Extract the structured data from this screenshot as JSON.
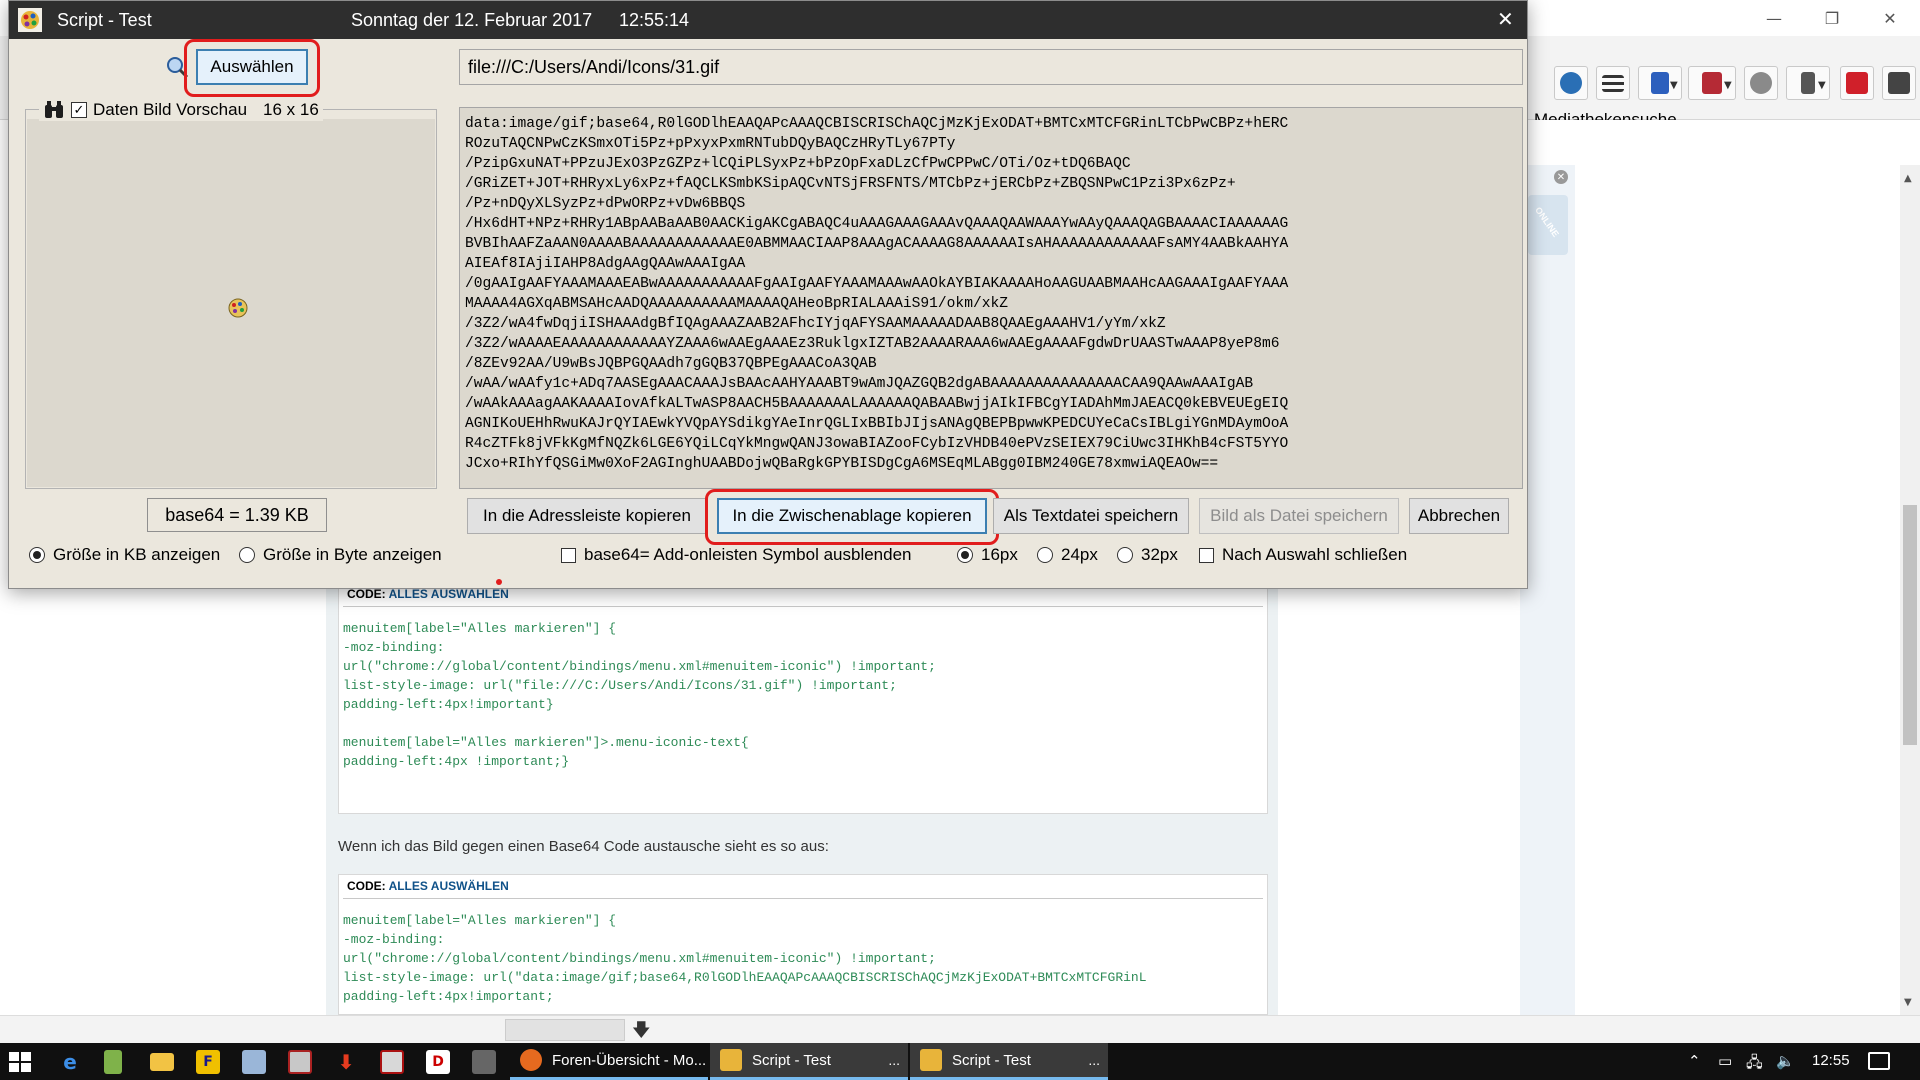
{
  "browser": {
    "bookmark": "Mediathekensuche",
    "side_badge": "ONLINE",
    "post_text": "Wenn ich das Bild gegen einen Base64 Code austausche sieht es so aus:",
    "code1": {
      "head": "CODE:",
      "select": "ALLES AUSWÄHLEN",
      "lines": [
        "menuitem[label=\"Alles markieren\"] {",
        "-moz-binding:",
        "url(\"chrome://global/content/bindings/menu.xml#menuitem-iconic\") !important;",
        "list-style-image: url(\"file:///C:/Users/Andi/Icons/31.gif\") !important;",
        "padding-left:4px!important}",
        "",
        "menuitem[label=\"Alles markieren\"]>.menu-iconic-text{",
        "padding-left:4px !important;}"
      ]
    },
    "code2": {
      "head": "CODE:",
      "select": "ALLES AUSWÄHLEN",
      "lines": [
        "menuitem[label=\"Alles markieren\"] {",
        "-moz-binding:",
        "url(\"chrome://global/content/bindings/menu.xml#menuitem-iconic\") !important;",
        "list-style-image: url(\"data:image/gif;base64,R0lGODlhEAAQAPcAAAQCBISCRISChAQCjMzKjExODAT+BMTCxMTCFGRinL",
        "padding-left:4px!important;"
      ]
    }
  },
  "dialog": {
    "title": "Script - Test",
    "date": "Sonntag der 12. Februar 2017",
    "time": "12:55:14",
    "close": "✕",
    "select_button": "Auswählen",
    "url": "file:///C:/Users/Andi/Icons/31.gif",
    "preview_label": "Daten Bild Vorschau",
    "preview_size": "16 x 16",
    "preview_checked": "✓",
    "base64_lines": [
      "data:image/gif;base64,R0lGODlhEAAQAPcAAAQCBISCRISChAQCjMzKjExODAT+BMTCxMTCFGRinLTCbPwCBPz+hERC",
      "ROzuTAQCNPwCzKSmxOTi5Pz+pPxyxPxmRNTubDQyBAQCzHRyTLy67PTy",
      "/PzipGxuNAT+PPzuJExO3PzGZPz+lCQiPLSyxPz+bPzOpFxaDLzCfPwCPPwC/OTi/Oz+tDQ6BAQC",
      "/GRiZET+JOT+RHRyxLy6xPz+fAQCLKSmbKSipAQCvNTSjFRSFNTS/MTCbPz+jERCbPz+ZBQSNPwC1Pzi3Px6zPz+",
      "/Pz+nDQyXLSyzPz+dPwORPz+vDw6BBQS",
      "/Hx6dHT+NPz+RHRy1ABpAABaAAB0AACKigAKCgABAQC4uAAAGAAAGAAAvQAAAQAAWAAAYwAAyQAAAQAGBAAAACIAAAAAAG",
      "BVBIhAAFZaAAN0AAAABAAAAAAAAAAAAE0ABMMAACIAAP8AAAgACAAAAG8AAAAAAIsAHAAAAAAAAAAAAFsAMY4AABkAAHYA",
      "AIEAf8IAjiIAHP8AdgAAgQAAwAAAIgAA",
      "/0gAAIgAAFYAAAMAAAEABwAAAAAAAAAAAFgAAIgAAFYAAAMAAAwAAOkAYBIAKAAAAHoAAGUAABMAAHcAAGAAAIgAAFYAAA",
      "MAAAA4AGXqABMSAHcAADQAAAAAAAAAAMAAAAQAHeoBpRIALAAAiS91/okm/xkZ",
      "/3Z2/wA4fwDqjiISHAAAdgBfIQAgAAAZAAB2AFhcIYjqAFYSAAMAAAAADAAB8QAAEgAAAHV1/yYm/xkZ",
      "/3Z2/wAAAAEAAAAAAAAAAAAYZAAA6wAAEgAAAEz3RuklgxIZTAB2AAAARAAA6wAAEgAAAAFgdwDrUAASTwAAAP8yeP8m6",
      "/8ZEv92AA/U9wBsJQBPGQAAdh7gGQB37QBPEgAAACoA3QAB",
      "/wAA/wAAfy1c+ADq7AASEgAAACAAAJsBAAcAAHYAAABT9wAmJQAZGQB2dgABAAAAAAAAAAAAAAACAA9QAAwAAAIgAB",
      "/wAAkAAAagAAKAAAAIovAfkALTwASP8AACH5BAAAAAAALAAAAAAQABAABwjjAIkIFBCgYIADAhMmJAEACQ0kEBVEUEgEIQ",
      "AGNIKoUEHhRwuKAJrQYIAEwkYVQpAYSdikgYAeInrQGLIxBBIbJIjsANAgQBEPBpwwKPEDCUYeCaCsIBLgiYGnMDAymOoA",
      "R4cZTFk8jVFkKgMfNQZk6LGE6YQiLCqYkMngwQANJ3owaBIAZooFCybIzVHDB40ePVzSEIEX79CiUwc3IHKhB4cFST5YYO",
      "JCxo+RIhYfQSGiMw0XoF2AGInghUAABDojwQBaRgkGPYBISDgCgA6MSEqMLABgg0IBM240GE78xmwiAQEAOw=="
    ],
    "size_value": "base64 = 1.39 KB",
    "buttons": {
      "addressbar": "In die Adressleiste kopieren",
      "clipboard": "In die Zwischenablage kopieren",
      "textfile": "Als Textdatei speichern",
      "imagefile": "Bild als Datei speichern",
      "cancel": "Abbrechen"
    },
    "options": {
      "kb": "Größe in KB anzeigen",
      "byte": "Größe in Byte anzeigen",
      "hide_symbol": "base64= Add-onleisten Symbol ausblenden",
      "px16": "16px",
      "px24": "24px",
      "px32": "32px",
      "close_after": "Nach Auswahl schließen"
    }
  },
  "taskbar": {
    "tasks": [
      {
        "label": "Foren-Übersicht - Mo..."
      },
      {
        "label": "Script - Test"
      },
      {
        "label": "Script - Test"
      }
    ],
    "more": "...",
    "clock": "12:55"
  },
  "colors": {
    "dialog_bg": "#ebe7dd",
    "title_bg": "#2e2e2e",
    "highlight_ring": "#e11d1d",
    "code_green": "#2e8b57",
    "link_blue": "#105289"
  }
}
